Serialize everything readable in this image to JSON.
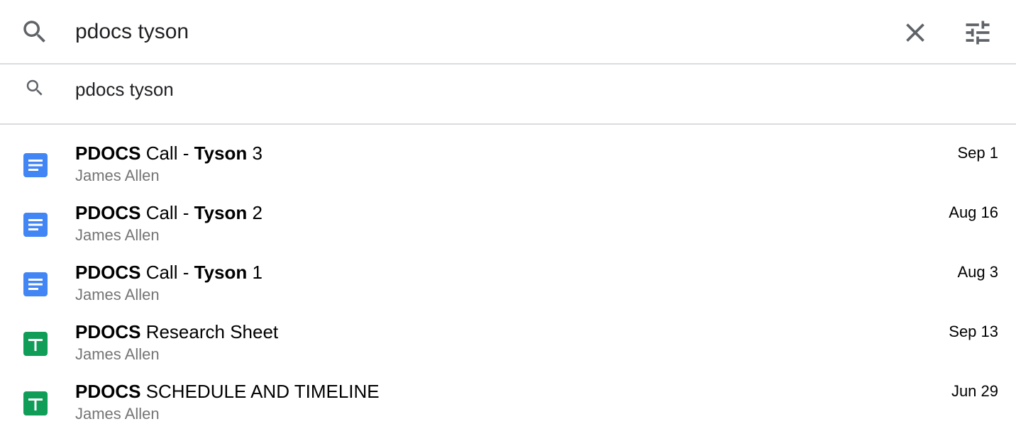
{
  "search": {
    "query": "pdocs tyson"
  },
  "suggestion": {
    "text": "pdocs tyson"
  },
  "colors": {
    "docs_blue": "#4285F4",
    "sheets_green": "#0F9D58",
    "icon_gray": "#5f6368",
    "secondary_text": "#757575",
    "divider": "#dadce0"
  },
  "results": [
    {
      "title_bold_1": "PDOCS",
      "title_plain_1": " Call - ",
      "title_bold_2": "Tyson",
      "title_plain_2": " 3",
      "owner": "James Allen",
      "date": "Sep 1",
      "icon": "google-docs-icon"
    },
    {
      "title_bold_1": "PDOCS",
      "title_plain_1": " Call - ",
      "title_bold_2": "Tyson",
      "title_plain_2": " 2",
      "owner": "James Allen",
      "date": "Aug 16",
      "icon": "google-docs-icon"
    },
    {
      "title_bold_1": "PDOCS",
      "title_plain_1": " Call - ",
      "title_bold_2": "Tyson",
      "title_plain_2": " 1",
      "owner": "James Allen",
      "date": "Aug 3",
      "icon": "google-docs-icon"
    },
    {
      "title_bold_1": "PDOCS",
      "title_plain_1": " Research Sheet",
      "title_bold_2": "",
      "title_plain_2": "",
      "owner": "James Allen",
      "date": "Sep 13",
      "icon": "google-sheets-icon"
    },
    {
      "title_bold_1": "PDOCS",
      "title_plain_1": " SCHEDULE AND TIMELINE",
      "title_bold_2": "",
      "title_plain_2": "",
      "owner": "James Allen",
      "date": "Jun 29",
      "icon": "google-sheets-icon"
    }
  ]
}
